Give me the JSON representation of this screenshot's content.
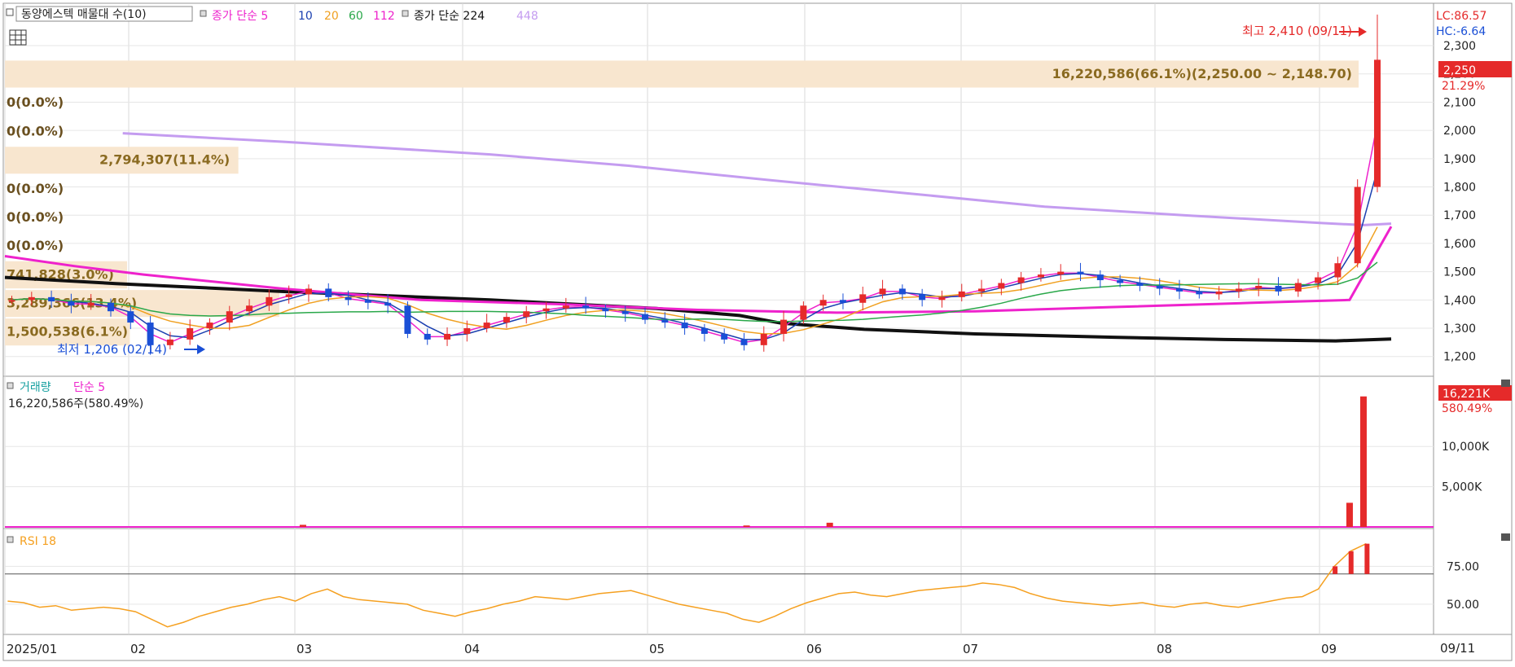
{
  "header": {
    "stock_label": "동양에스텍 매물대 수(10)",
    "ma_group1_label": "종가 단순 5",
    "ma_group1_periods": [
      "10",
      "20",
      "60",
      "112"
    ],
    "ma_group2_label": "종가 단순 224",
    "ma_group2_period": "448"
  },
  "price_panel": {
    "lc_label": "LC:86.57",
    "hc_label": "HC:-6.64",
    "last_price_tag": "2,250",
    "change_pct": "21.29%",
    "high_annotation": "최고 2,410 (09/11)",
    "low_annotation": "최저 1,206 (02/14)"
  },
  "volume_panel": {
    "title_prefix": "거래량",
    "title_ma": "단순 5",
    "volume_readout": "16,220,586주(580.49%)",
    "last_volume_tag": "16,221K",
    "volume_pct": "580.49%"
  },
  "rsi_panel": {
    "title": "RSI 18"
  },
  "date_axis": {
    "right_date": "09/11"
  },
  "colors": {
    "up": "#e52a2a",
    "down": "#1a4fd6",
    "ma5": "#ee22cc",
    "ma10": "#1a3fb0",
    "ma20": "#f0a020",
    "ma60": "#2aa84a",
    "ma112": "#ee22cc",
    "ma224": "#111111",
    "ma448": "#c49cf0",
    "profile_bar": "#f8e6cf",
    "profile_text": "#8a6a20",
    "rsi": "#f5a020"
  },
  "chart_data": [
    {
      "type": "candlestick",
      "title": "동양에스텍 매물대 수(10)",
      "x_range": [
        "2025/01",
        "09/11"
      ],
      "x_ticks": [
        "2025/01",
        "02",
        "03",
        "04",
        "05",
        "06",
        "07",
        "08",
        "09"
      ],
      "y_ticks": [
        "1,200",
        "1,300",
        "1,400",
        "1,500",
        "1,600",
        "1,700",
        "1,800",
        "1,900",
        "2,000",
        "2,100",
        "2,200",
        "2,300"
      ],
      "ylim": [
        1130,
        2450
      ],
      "last_close": 2250,
      "high": {
        "value": 2410,
        "date": "09/11"
      },
      "low": {
        "value": 1206,
        "date": "02/14"
      },
      "volume_profile": [
        {
          "label": "16,220,586(66.1%)(2,250.00 ~ 2,148.70)",
          "price_from": 2148.7,
          "price_to": 2250,
          "fraction": 0.661
        },
        {
          "label": "0(0.0%)",
          "price_from": 2047,
          "price_to": 2148.7,
          "fraction": 0
        },
        {
          "label": "0(0.0%)",
          "price_from": 1945,
          "price_to": 2047,
          "fraction": 0
        },
        {
          "label": "2,794,307(11.4%)",
          "price_from": 1844,
          "price_to": 1945,
          "fraction": 0.114
        },
        {
          "label": "0(0.0%)",
          "price_from": 1743,
          "price_to": 1844,
          "fraction": 0
        },
        {
          "label": "0(0.0%)",
          "price_from": 1641,
          "price_to": 1743,
          "fraction": 0
        },
        {
          "label": "0(0.0%)",
          "price_from": 1540,
          "price_to": 1641,
          "fraction": 0
        },
        {
          "label": "741,828(3.0%)",
          "price_from": 1438,
          "price_to": 1540,
          "fraction": 0.03
        },
        {
          "label": "3,289,366(13.4%)",
          "price_from": 1337,
          "price_to": 1438,
          "fraction": 0.134
        },
        {
          "label": "1,500,538(6.1%)",
          "price_from": 1236,
          "price_to": 1337,
          "fraction": 0.061
        }
      ],
      "moving_averages": [
        {
          "period": 224,
          "points": [
            [
              0,
              1480
            ],
            [
              0.08,
              1458
            ],
            [
              0.2,
              1430
            ],
            [
              0.35,
              1400
            ],
            [
              0.47,
              1370
            ],
            [
              0.53,
              1345
            ],
            [
              0.56,
              1318
            ],
            [
              0.62,
              1296
            ],
            [
              0.7,
              1280
            ],
            [
              0.8,
              1268
            ],
            [
              0.88,
              1260
            ],
            [
              0.96,
              1255
            ],
            [
              1,
              1262
            ]
          ]
        },
        {
          "period": 448,
          "points": [
            [
              0.085,
              1990
            ],
            [
              0.2,
              1960
            ],
            [
              0.35,
              1915
            ],
            [
              0.45,
              1875
            ],
            [
              0.55,
              1825
            ],
            [
              0.65,
              1778
            ],
            [
              0.75,
              1730
            ],
            [
              0.85,
              1700
            ],
            [
              0.95,
              1672
            ],
            [
              0.98,
              1665
            ],
            [
              1,
              1670
            ]
          ]
        },
        {
          "period": 112,
          "points": [
            [
              0,
              1555
            ],
            [
              0.05,
              1520
            ],
            [
              0.1,
              1490
            ],
            [
              0.2,
              1440
            ],
            [
              0.3,
              1400
            ],
            [
              0.4,
              1385
            ],
            [
              0.5,
              1365
            ],
            [
              0.6,
              1355
            ],
            [
              0.7,
              1360
            ],
            [
              0.8,
              1375
            ],
            [
              0.9,
              1390
            ],
            [
              0.97,
              1400
            ],
            [
              1,
              1660
            ]
          ]
        }
      ],
      "price_series": [
        1400,
        1410,
        1395,
        1380,
        1390,
        1360,
        1320,
        1240,
        1260,
        1300,
        1320,
        1360,
        1380,
        1410,
        1420,
        1440,
        1410,
        1400,
        1390,
        1380,
        1280,
        1260,
        1280,
        1300,
        1320,
        1340,
        1360,
        1370,
        1380,
        1370,
        1360,
        1350,
        1330,
        1320,
        1300,
        1280,
        1260,
        1240,
        1280,
        1330,
        1380,
        1400,
        1390,
        1420,
        1440,
        1420,
        1400,
        1410,
        1430,
        1440,
        1460,
        1480,
        1490,
        1500,
        1490,
        1470,
        1460,
        1450,
        1440,
        1430,
        1420,
        1430,
        1440,
        1450,
        1430,
        1460,
        1480,
        1530,
        1800,
        2250
      ]
    },
    {
      "type": "bar",
      "title": "거래량 단순 5",
      "y_ticks": [
        "5,000K",
        "10,000K"
      ],
      "ylim": [
        0,
        16500
      ],
      "last_value_k": 16221,
      "spikes": [
        {
          "pos": 0.215,
          "value_k": 260
        },
        {
          "pos": 0.535,
          "value_k": 180
        },
        {
          "pos": 0.595,
          "value_k": 520
        },
        {
          "pos": 0.97,
          "value_k": 3000
        },
        {
          "pos": 0.98,
          "value_k": 16221
        }
      ]
    },
    {
      "type": "line",
      "title": "RSI 18",
      "y_ticks": [
        "50.00",
        "75.00"
      ],
      "ylim": [
        30,
        100
      ],
      "guide_level": 70,
      "values": [
        52,
        51,
        48,
        49,
        46,
        47,
        48,
        47,
        45,
        40,
        35,
        38,
        42,
        45,
        48,
        50,
        53,
        55,
        52,
        57,
        60,
        55,
        53,
        52,
        51,
        50,
        46,
        44,
        42,
        45,
        47,
        50,
        52,
        55,
        54,
        53,
        55,
        57,
        58,
        59,
        56,
        53,
        50,
        48,
        46,
        44,
        40,
        38,
        42,
        47,
        51,
        54,
        57,
        58,
        56,
        55,
        57,
        59,
        60,
        61,
        62,
        64,
        63,
        61,
        57,
        54,
        52,
        51,
        50,
        49,
        50,
        51,
        49,
        48,
        50,
        51,
        49,
        48,
        50,
        52,
        54,
        55,
        60,
        75,
        85,
        90
      ]
    }
  ]
}
